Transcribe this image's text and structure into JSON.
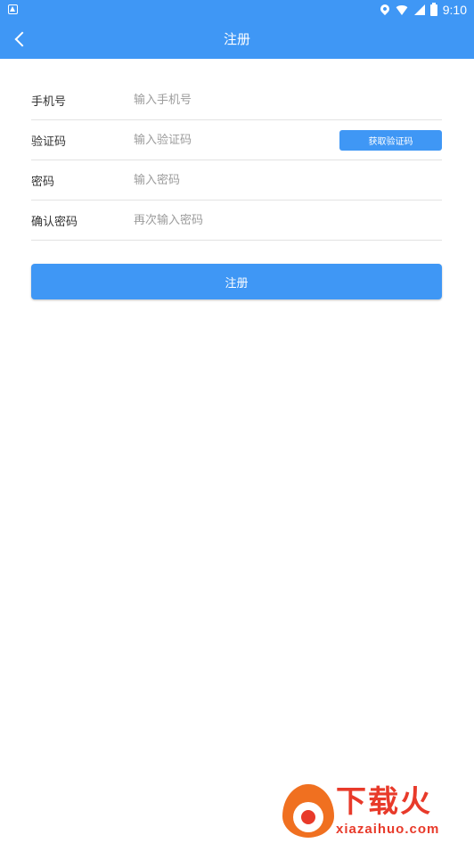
{
  "status_bar": {
    "time": "9:10",
    "icons": [
      "notification-icon",
      "location-icon",
      "wifi-icon",
      "signal-icon",
      "battery-icon"
    ]
  },
  "header": {
    "title": "注册",
    "back_icon": "chevron-left-icon"
  },
  "form": {
    "phone": {
      "label": "手机号",
      "placeholder": "输入手机号",
      "value": ""
    },
    "code": {
      "label": "验证码",
      "placeholder": "输入验证码",
      "value": "",
      "button_label": "获取验证码"
    },
    "password": {
      "label": "密码",
      "placeholder": "输入密码",
      "value": ""
    },
    "confirm_password": {
      "label": "确认密码",
      "placeholder": "再次输入密码",
      "value": ""
    }
  },
  "submit_label": "注册",
  "watermark": {
    "brand": "下载火",
    "domain": "xiazaihuo.com"
  },
  "colors": {
    "primary": "#3f97f5",
    "background": "#ffffff",
    "label": "#333333",
    "placeholder": "#9c9c9c",
    "divider": "#e2e2e2",
    "watermark": "#e83a2a"
  }
}
